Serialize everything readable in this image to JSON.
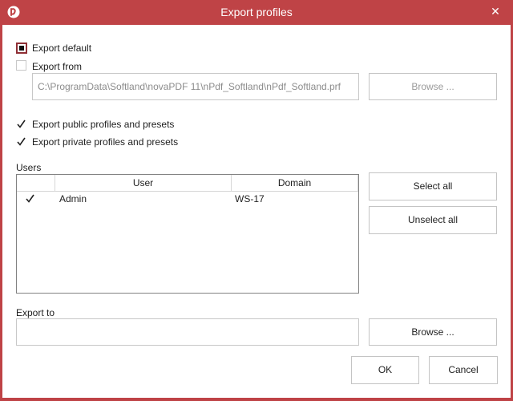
{
  "window": {
    "title": "Export profiles",
    "close_glyph": "✕",
    "accent_color": "#bf4346"
  },
  "options": {
    "export_default": {
      "label": "Export default",
      "state": "indeterminate"
    },
    "export_from": {
      "label": "Export from",
      "checked": false,
      "path": "C:\\ProgramData\\Softland\\novaPDF 11\\nPdf_Softland\\nPdf_Softland.prf",
      "browse_label": "Browse ..."
    },
    "export_public": {
      "label": "Export public profiles and presets",
      "checked": true
    },
    "export_private": {
      "label": "Export private profiles and presets",
      "checked": true
    }
  },
  "users": {
    "group_label": "Users",
    "columns": [
      "User",
      "Domain"
    ],
    "rows": [
      {
        "checked": true,
        "user": "Admin",
        "domain": "WS-17"
      }
    ],
    "select_all_label": "Select all",
    "unselect_all_label": "Unselect all"
  },
  "export_to": {
    "label": "Export to",
    "value": "",
    "browse_label": "Browse ..."
  },
  "footer": {
    "ok_label": "OK",
    "cancel_label": "Cancel"
  }
}
